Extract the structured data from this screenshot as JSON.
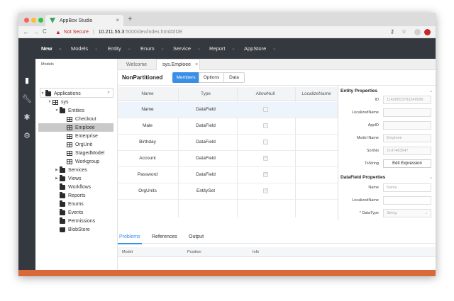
{
  "browser": {
    "traffic_colors": [
      "#ff5f57",
      "#febc2e",
      "#28c840"
    ],
    "tab_title": "AppBox Studio",
    "new_tab": "+",
    "tab_close": "×",
    "back": "←",
    "forward": "→",
    "reload": "C",
    "security_text": "Not Secure",
    "url_separator": "|",
    "url_host": "10.211.55.3",
    "url_path": ":5000/dev/index.html#/IDE"
  },
  "menu": [
    {
      "label": "New"
    },
    {
      "label": "Models"
    },
    {
      "label": "Entity"
    },
    {
      "label": "Enum"
    },
    {
      "label": "Service"
    },
    {
      "label": "Report"
    },
    {
      "label": "AppStore"
    }
  ],
  "tree": {
    "panel_label": "Models",
    "search_placeholder": "",
    "nodes": [
      {
        "label": "Applications",
        "icon": "folder-icon"
      },
      {
        "label": "sys",
        "icon": "grid-icon"
      },
      {
        "label": "Entities",
        "icon": "folder-icon"
      },
      {
        "label": "Checkout",
        "icon": "table-icon"
      },
      {
        "label": "Emploee",
        "icon": "table-icon"
      },
      {
        "label": "Enterprise",
        "icon": "table-icon"
      },
      {
        "label": "OrgUnit",
        "icon": "table-icon"
      },
      {
        "label": "StagedModel",
        "icon": "table-icon"
      },
      {
        "label": "Workgroup",
        "icon": "table-icon"
      },
      {
        "label": "Services",
        "icon": "folder-icon"
      },
      {
        "label": "Views",
        "icon": "folder-icon"
      },
      {
        "label": "Workflows",
        "icon": "folder-icon"
      },
      {
        "label": "Reports",
        "icon": "folder-icon"
      },
      {
        "label": "Enums",
        "icon": "folder-icon"
      },
      {
        "label": "Events",
        "icon": "folder-icon"
      },
      {
        "label": "Permissions",
        "icon": "folder-icon"
      },
      {
        "label": "BlobStore",
        "icon": "package-icon"
      }
    ]
  },
  "doc_tabs": [
    {
      "label": "Welcome"
    },
    {
      "label": "sys.Emploee"
    }
  ],
  "content": {
    "partition": "NonPartitioned",
    "segments": [
      {
        "label": "Members",
        "active": true
      },
      {
        "label": "Options"
      },
      {
        "label": "Data"
      }
    ],
    "columns": [
      "Name",
      "Type",
      "AllowNull",
      "LocalizeName"
    ],
    "rows": [
      {
        "name": "Name",
        "type": "DataField",
        "allow_null": false
      },
      {
        "name": "Male",
        "type": "DataField",
        "allow_null": false
      },
      {
        "name": "Birthday",
        "type": "DataField",
        "allow_null": false
      },
      {
        "name": "Account",
        "type": "DataField",
        "allow_null": true
      },
      {
        "name": "Password",
        "type": "DataField",
        "allow_null": true
      },
      {
        "name": "OrgUnits",
        "type": "EntitySet",
        "allow_null": true
      }
    ]
  },
  "entity_properties": {
    "title": "Entity Properties",
    "fields": [
      {
        "label": "ID",
        "value": "11428653783249999"
      },
      {
        "label": "LocalizedName",
        "value": ""
      },
      {
        "label": "AppID",
        "value": ""
      },
      {
        "label": "Model Name",
        "value": "Emploee"
      },
      {
        "label": "SortNo",
        "value": "2147483647"
      },
      {
        "label": "ToString",
        "value": "Edit Expression"
      }
    ]
  },
  "datafield_properties": {
    "title": "DataField Properties",
    "fields": [
      {
        "label": "Name",
        "value": "Name"
      },
      {
        "label": "LocalizedName",
        "value": ""
      },
      {
        "label": "* DataType",
        "value": "String"
      }
    ]
  },
  "bottom": {
    "tabs": [
      {
        "label": "Problems",
        "active": true
      },
      {
        "label": "References"
      },
      {
        "label": "Output"
      }
    ],
    "columns": [
      "Model",
      "Position",
      "Info"
    ]
  },
  "colors": {
    "accent": "#3a8ee6",
    "menubar": "#34383f",
    "footer": "#d7693a",
    "warning": "#c62828"
  }
}
